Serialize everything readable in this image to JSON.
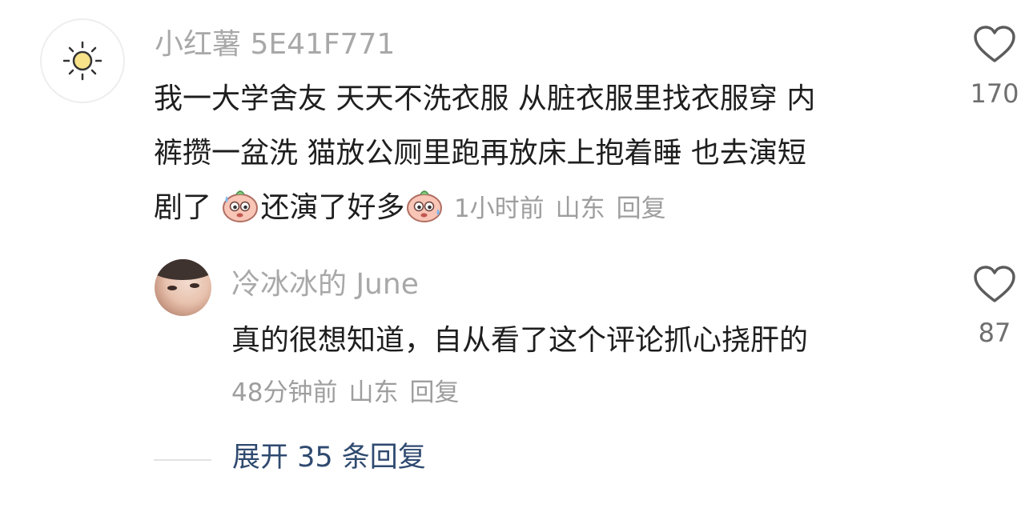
{
  "comment": {
    "username": "小红薯 5E41F771",
    "lines": [
      "我一大学舍友 天天不洗衣服 从脏衣服里找衣服穿 内",
      "裤攒一盆洗 猫放公厕里跑再放床上抱着睡  也去演短",
      "剧了"
    ],
    "text_mid": "还演了好多",
    "time": "1小时前",
    "location": "山东",
    "reply_label": "回复",
    "likes": "170",
    "avatar_icon": "sun-icon",
    "emoji_icon": "sweating-face-emoji"
  },
  "reply": {
    "username": "冷冰冰的 June",
    "text": "真的很想知道，自从看了这个评论抓心挠肝的",
    "time": "48分钟前",
    "location": "山东",
    "reply_label": "回复",
    "likes": "87"
  },
  "expand": {
    "label": "展开 35 条回复"
  },
  "colors": {
    "username": "#a8a8a8",
    "text": "#1e1e1e",
    "meta": "#9e9e9e",
    "expand": "#2f4a70",
    "icon": "#5c5c5c"
  }
}
